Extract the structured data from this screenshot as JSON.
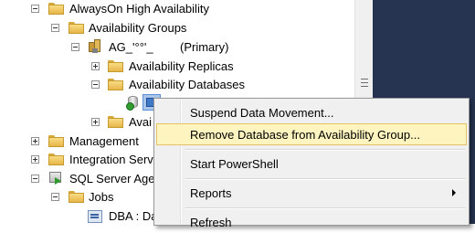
{
  "tree": {
    "alwayson": "AlwaysOn High Availability",
    "availability_groups": "Availability Groups",
    "ag_name": "AG_'°°'_",
    "ag_role": "(Primary)",
    "availability_replicas": "Availability Replicas",
    "availability_databases": "Availability Databases",
    "availability_partial": "Avai",
    "management": "Management",
    "integration_partial": "Integration Serv",
    "sql_agent_partial": "SQL Server Age",
    "jobs": "Jobs",
    "job_item_partial": "DBA : Da"
  },
  "context_menu": {
    "suspend": "Suspend Data Movement...",
    "remove": "Remove Database from Availability Group...",
    "powershell": "Start PowerShell",
    "reports": "Reports",
    "refresh": "Refresh"
  },
  "colors": {
    "highlight_bg": "#fdf4bf",
    "highlight_border": "#e5c365",
    "right_pane": "#273451"
  }
}
